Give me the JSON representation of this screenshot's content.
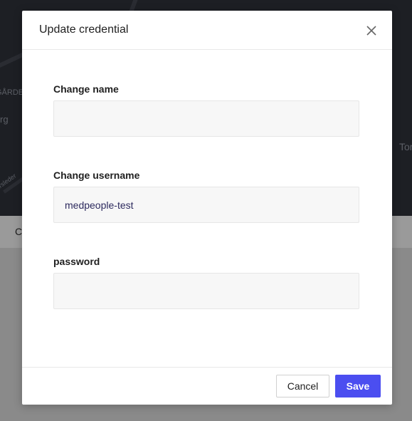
{
  "background": {
    "strip_text": "C",
    "map_texts": [
      "GÅRDE",
      "rg",
      "arsleder",
      "Tor"
    ]
  },
  "dialog": {
    "title": "Update credential",
    "fields": [
      {
        "label": "Change name",
        "value": "",
        "placeholder": ""
      },
      {
        "label": "Change username",
        "value": "medpeople-test",
        "placeholder": ""
      },
      {
        "label": "password",
        "value": "",
        "placeholder": ""
      }
    ],
    "buttons": {
      "cancel": "Cancel",
      "save": "Save"
    }
  },
  "colors": {
    "accent": "#4b4ef0",
    "input_bg": "#f7f7f7",
    "input_text": "#2d2a5e"
  },
  "icons": {
    "close": "close-icon"
  }
}
